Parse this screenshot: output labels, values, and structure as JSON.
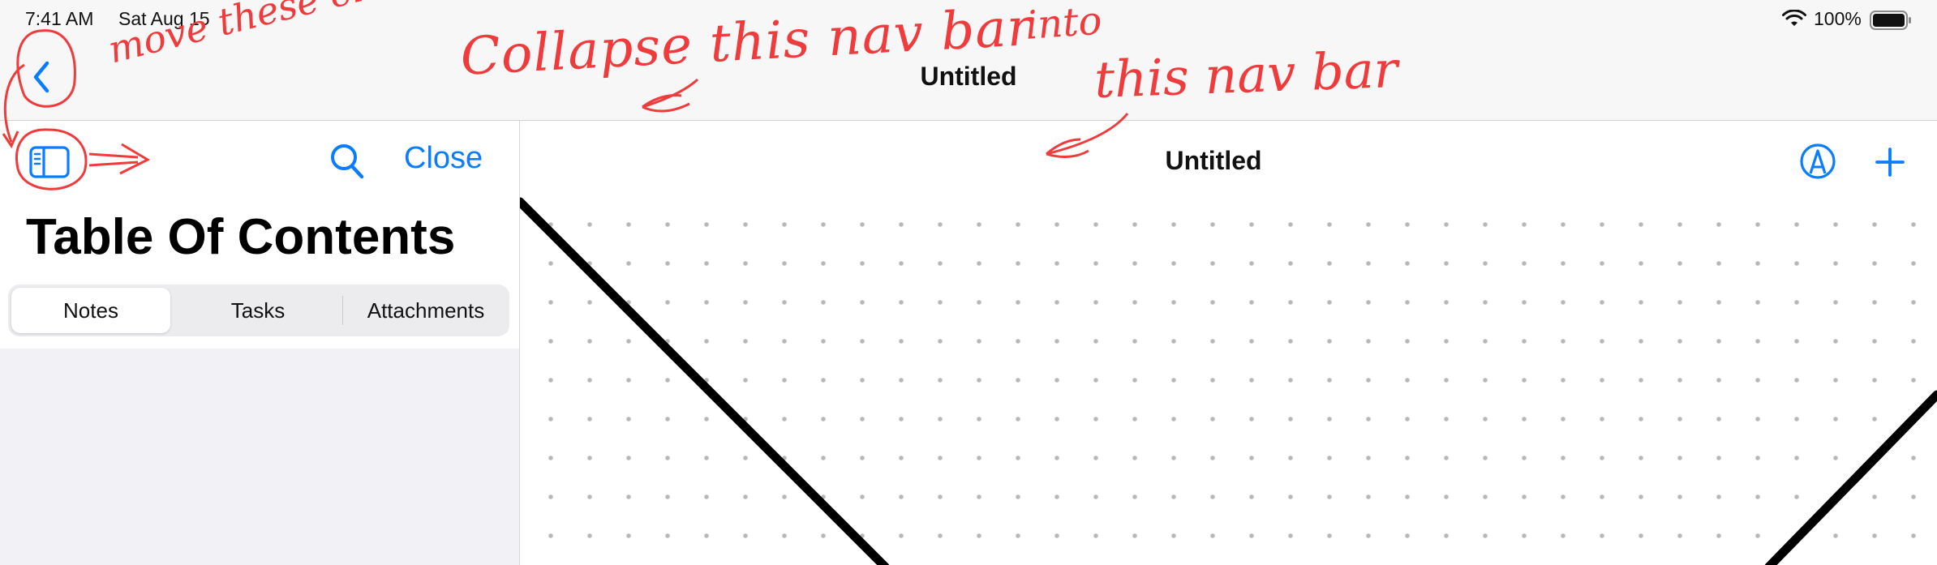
{
  "status_bar": {
    "time": "7:41 AM",
    "date": "Sat Aug 15",
    "battery": "100%"
  },
  "top_nav": {
    "title": "Untitled",
    "back_icon": "chevron-left-icon"
  },
  "sidebar": {
    "toggle_icon": "sidebar-icon",
    "search_icon": "search-icon",
    "close_label": "Close",
    "title": "Table Of Contents",
    "segments": [
      {
        "label": "Notes",
        "selected": true
      },
      {
        "label": "Tasks",
        "selected": false
      },
      {
        "label": "Attachments",
        "selected": false
      }
    ]
  },
  "canvas": {
    "title": "Untitled",
    "markup_icon": "pen-tip-icon",
    "add_icon": "plus-icon"
  },
  "annotations": {
    "move_these": "move these elements",
    "collapse": "Collapse this nav bar",
    "into": "into",
    "this_nav_bar": "this nav bar"
  },
  "colors": {
    "accent": "#0a7cff",
    "annotation": "#ef3b3b",
    "nav_background": "#f7f7f7",
    "sidebar_background": "#f2f2f6"
  }
}
